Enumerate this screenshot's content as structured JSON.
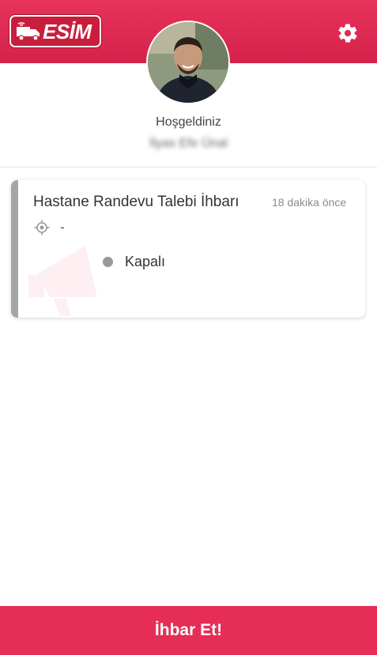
{
  "header": {
    "logo_text": "ESİM",
    "colors": {
      "primary": "#e52d55",
      "logo_bg": "#c81e3c"
    }
  },
  "profile": {
    "welcome": "Hoşgeldiniz",
    "name": "İlyas Efe Ünal"
  },
  "notices": [
    {
      "title": "Hastane Randevu Talebi İhbarı",
      "time": "18 dakika önce",
      "location": "-",
      "status": "Kapalı",
      "status_color": "#999999"
    }
  ],
  "footer": {
    "button_label": "İhbar Et!"
  },
  "icons": {
    "settings": "gear-icon",
    "location": "location-target-icon",
    "logo": "truck-icon",
    "card_watermark": "megaphone-icon"
  }
}
